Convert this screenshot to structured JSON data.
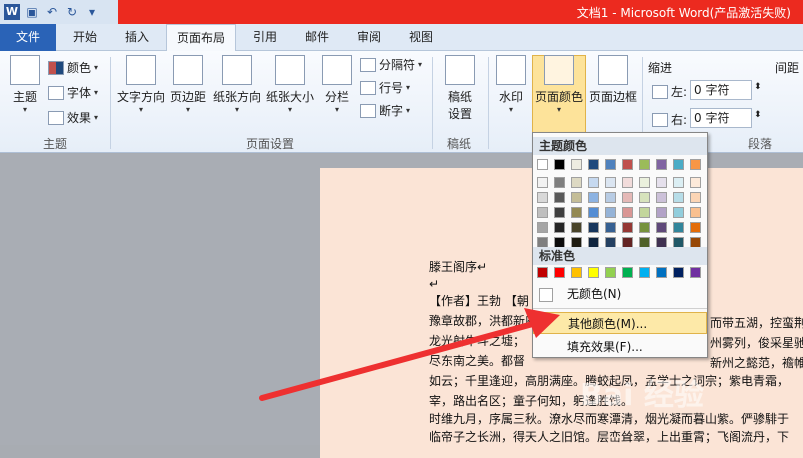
{
  "window": {
    "title": "文档1 - Microsoft Word(产品激活失败)",
    "app_icon": "W"
  },
  "qat": {
    "save": "save-icon",
    "undo": "undo-icon",
    "redo": "redo-icon",
    "more": "▾"
  },
  "tabs": [
    {
      "label": "文件"
    },
    {
      "label": "开始"
    },
    {
      "label": "插入"
    },
    {
      "label": "页面布局"
    },
    {
      "label": "引用"
    },
    {
      "label": "邮件"
    },
    {
      "label": "审阅"
    },
    {
      "label": "视图"
    }
  ],
  "ribbon": {
    "theme": {
      "themes": "主题",
      "colors": "颜色",
      "fonts": "字体",
      "effects": "效果",
      "group": "主题"
    },
    "page_setup": {
      "direction": "文字方向",
      "margins": "页边距",
      "orientation": "纸张方向",
      "size": "纸张大小",
      "columns": "分栏",
      "breaks": "分隔符",
      "line_numbers": "行号",
      "hyphenation": "断字",
      "group": "页面设置"
    },
    "draft": {
      "label1": "稿纸",
      "label2": "设置",
      "group": "稿纸"
    },
    "background": {
      "watermark": "水印",
      "page_color": "页面颜色",
      "page_borders": "页面边框"
    },
    "paragraph": {
      "indent": "缩进",
      "spacing": "间距",
      "left": "左:",
      "right": "右:",
      "left_value": "0 字符",
      "right_value": "0 字符",
      "group": "段落"
    }
  },
  "menu": {
    "theme_colors_header": "主题颜色",
    "standard_colors_header": "标准色",
    "no_color": "无颜色(N)",
    "more_colors": "其他颜色(M)...",
    "fill_effects": "填充效果(F)...",
    "theme_top": [
      "#ffffff",
      "#000000",
      "#eeece1",
      "#1f497d",
      "#4f81bd",
      "#c0504d",
      "#9bbb59",
      "#8064a2",
      "#4bacc6",
      "#f79646"
    ],
    "theme_shades": [
      [
        "#f2f2f2",
        "#7f7f7f",
        "#ddd9c3",
        "#c6d9f0",
        "#dbe5f1",
        "#f2dcdb",
        "#ebf1dd",
        "#e5e0ec",
        "#dbeef3",
        "#fdeada"
      ],
      [
        "#d8d8d8",
        "#595959",
        "#c4bd97",
        "#8db3e2",
        "#b8cce4",
        "#e5b9b7",
        "#d7e3bc",
        "#ccc1d9",
        "#b7dde8",
        "#fbd5b5"
      ],
      [
        "#bfbfbf",
        "#3f3f3f",
        "#938953",
        "#548dd4",
        "#95b3d7",
        "#d99694",
        "#c3d69b",
        "#b2a2c7",
        "#92cddc",
        "#fac08f"
      ],
      [
        "#a5a5a5",
        "#262626",
        "#494429",
        "#17365d",
        "#366092",
        "#953734",
        "#76923c",
        "#5f497a",
        "#31859b",
        "#e36c09"
      ],
      [
        "#7f7f7f",
        "#0c0c0c",
        "#1d1b10",
        "#0f243e",
        "#244061",
        "#632423",
        "#4f6128",
        "#3f3151",
        "#205867",
        "#974806"
      ]
    ],
    "standard": [
      "#c00000",
      "#ff0000",
      "#ffc000",
      "#ffff00",
      "#92d050",
      "#00b050",
      "#00b0f0",
      "#0070c0",
      "#002060",
      "#7030a0"
    ]
  },
  "document": {
    "lines": [
      "滕王阁序↵",
      "↵",
      "【作者】王勃 【朝",
      "豫章故郡，洪都新府",
      "龙光射牛斗之墟；",
      "尽东南之美。都督",
      "如云；千里逢迎，高朋满座。腾蛟起凤，孟学士之词宗；紫电青霜，",
      "宰，路出名区；童子何知，躬逢胜饯。",
      "时维九月，序属三秋。潦水尽而寒潭清，烟光凝而暮山紫。俨骖騑于",
      "临帝子之长洲，得天人之旧馆。层峦耸翠，上出重霄；飞阁流丹，下"
    ],
    "right_fragments": [
      "而带五湖，控蛮荆",
      "州雾列，俊采星驰",
      "新州之懿范，襜帷"
    ]
  },
  "watermark": "Bai 经验"
}
